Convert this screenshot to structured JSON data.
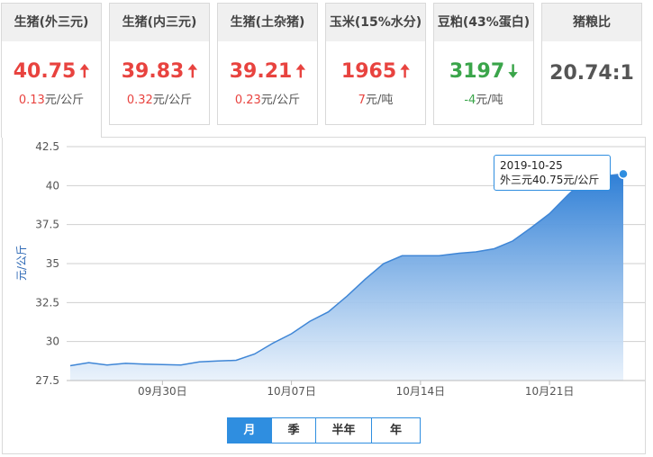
{
  "cards": [
    {
      "title": "生猪(外三元)",
      "price": "40.75",
      "direction": "up",
      "change": "0.13",
      "unit": "元/公斤"
    },
    {
      "title": "生猪(内三元)",
      "price": "39.83",
      "direction": "up",
      "change": "0.32",
      "unit": "元/公斤"
    },
    {
      "title": "生猪(土杂猪)",
      "price": "39.21",
      "direction": "up",
      "change": "0.23",
      "unit": "元/公斤"
    },
    {
      "title": "玉米(15%水分)",
      "price": "1965",
      "direction": "up",
      "change": "7",
      "unit": "元/吨"
    },
    {
      "title": "豆粕(43%蛋白)",
      "price": "3197",
      "direction": "down",
      "change": "-4",
      "unit": "元/吨"
    },
    {
      "title": "猪粮比",
      "ratio": "20.74:1"
    }
  ],
  "arrow_up": "🠅",
  "arrow_down": "🠇",
  "tooltip": {
    "date": "2019-10-25",
    "text": "外三元40.75元/公斤"
  },
  "periods": {
    "month": "月",
    "season": "季",
    "half_year": "半年",
    "year": "年"
  },
  "colors": {
    "up": "#e8433f",
    "down": "#3aa54a",
    "accent": "#2f8ee0",
    "line": "#3f86d6"
  },
  "chart_data": {
    "type": "area",
    "ylabel": "元/公斤",
    "ylim": [
      27.5,
      42.5
    ],
    "yticks": [
      "27.5",
      "30",
      "32.5",
      "35",
      "37.5",
      "40",
      "42.5"
    ],
    "xticks": [
      {
        "label": "09月30日",
        "date": "2019-09-30"
      },
      {
        "label": "10月07日",
        "date": "2019-10-07"
      },
      {
        "label": "10月14日",
        "date": "2019-10-14"
      },
      {
        "label": "10月21日",
        "date": "2019-10-21"
      }
    ],
    "grid": true,
    "series": [
      {
        "name": "外三元",
        "x": [
          "2019-09-25",
          "2019-09-26",
          "2019-09-27",
          "2019-09-28",
          "2019-09-29",
          "2019-09-30",
          "2019-10-01",
          "2019-10-02",
          "2019-10-03",
          "2019-10-04",
          "2019-10-05",
          "2019-10-06",
          "2019-10-07",
          "2019-10-08",
          "2019-10-09",
          "2019-10-10",
          "2019-10-11",
          "2019-10-12",
          "2019-10-13",
          "2019-10-14",
          "2019-10-15",
          "2019-10-16",
          "2019-10-17",
          "2019-10-18",
          "2019-10-19",
          "2019-10-20",
          "2019-10-21",
          "2019-10-22",
          "2019-10-23",
          "2019-10-24",
          "2019-10-25"
        ],
        "values": [
          28.45,
          28.65,
          28.5,
          28.6,
          28.55,
          28.52,
          28.5,
          28.7,
          28.75,
          28.8,
          29.2,
          29.9,
          30.5,
          31.3,
          31.9,
          32.9,
          34.0,
          35.0,
          35.5,
          35.5,
          35.5,
          35.65,
          35.75,
          35.95,
          36.45,
          37.3,
          38.2,
          39.4,
          40.5,
          40.62,
          40.75
        ]
      }
    ]
  }
}
